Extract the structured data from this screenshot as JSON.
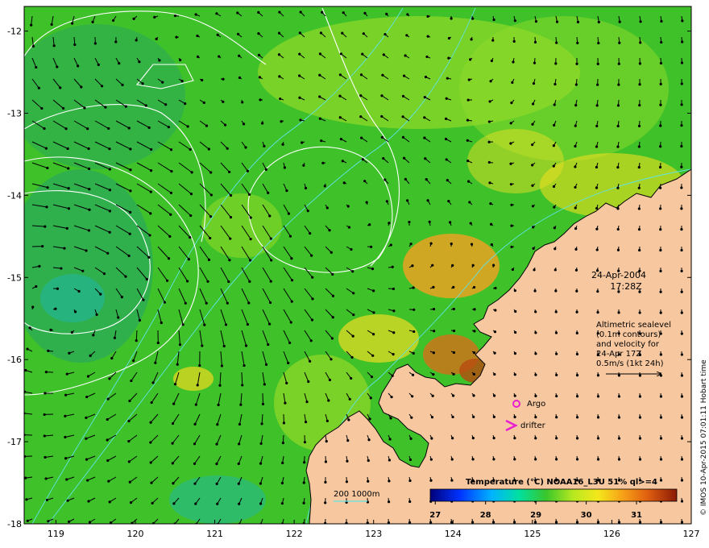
{
  "map": {
    "x_ticks": [
      "119",
      "120",
      "121",
      "122",
      "123",
      "124",
      "125",
      "126",
      "127"
    ],
    "y_ticks": [
      "-12",
      "-13",
      "-14",
      "-15",
      "-16",
      "-17",
      "-18"
    ],
    "lon_range": [
      118.6,
      127.0
    ],
    "lat_range": [
      -18.0,
      -11.7
    ],
    "date": "24-Apr-2004",
    "time": "17:28Z",
    "notes": [
      "Altimetric sealevel",
      "(0.1m contours)",
      "and velocity for",
      "24-Apr 17Z",
      "0.5m/s (1kt 24h)"
    ],
    "legend_argo": "Argo",
    "legend_drifter": "drifter",
    "depth_label": "200  1000m",
    "colorbar_title": "Temperature (°C) NOAA16_L3U 51% ql>=4",
    "colorbar_ticks": [
      "27",
      "28",
      "29",
      "30",
      "31"
    ],
    "credit": "© IMOS 10-Apr-2015 07:01:11 Hobart time",
    "colors": {
      "ocean": "#3fc12a",
      "land": "#f7c8a0",
      "contour": "#ffffff",
      "isobath": "#5fe3e8",
      "argo": "#e81ed0",
      "drifter": "#e81ed0"
    }
  }
}
